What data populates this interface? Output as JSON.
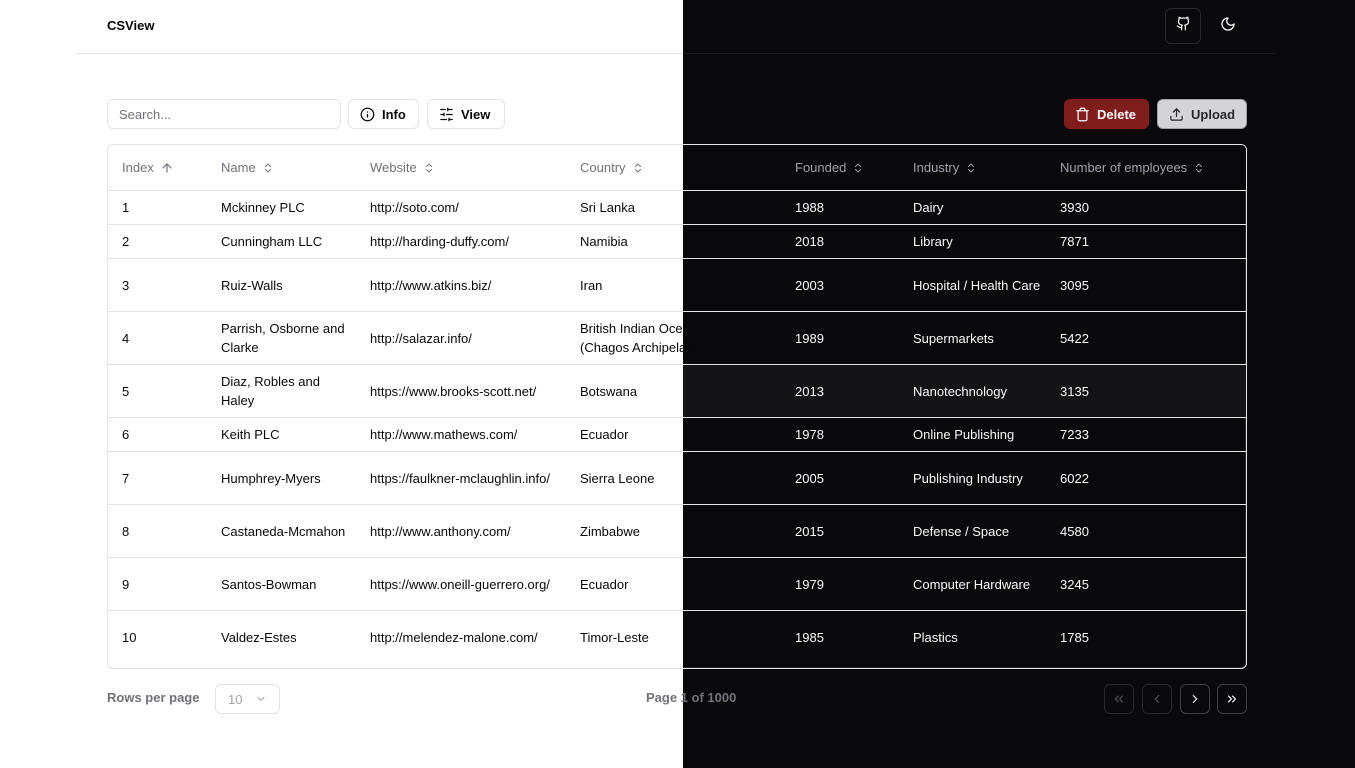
{
  "header": {
    "title": "CSView"
  },
  "toolbar": {
    "search_placeholder": "Search...",
    "info_label": "Info",
    "view_label": "View",
    "delete_label": "Delete",
    "upload_label": "Upload"
  },
  "table": {
    "columns": [
      "Index",
      "Name",
      "Website",
      "Country",
      "Founded",
      "Industry",
      "Number of employees"
    ],
    "rows": [
      [
        "1",
        "Mckinney PLC",
        "http://soto.com/",
        "Sri Lanka",
        "1988",
        "Dairy",
        "3930"
      ],
      [
        "2",
        "Cunningham LLC",
        "http://harding-duffy.com/",
        "Namibia",
        "2018",
        "Library",
        "7871"
      ],
      [
        "3",
        "Ruiz-Walls",
        "http://www.atkins.biz/",
        "Iran",
        "2003",
        "Hospital / Health Care",
        "3095"
      ],
      [
        "4",
        "Parrish, Osborne and Clarke",
        "http://salazar.info/",
        "British Indian Ocean Territory (Chagos Archipelago)",
        "1989",
        "Supermarkets",
        "5422"
      ],
      [
        "5",
        "Diaz, Robles and Haley",
        "https://www.brooks-scott.net/",
        "Botswana",
        "2013",
        "Nanotechnology",
        "3135"
      ],
      [
        "6",
        "Keith PLC",
        "http://www.mathews.com/",
        "Ecuador",
        "1978",
        "Online Publishing",
        "7233"
      ],
      [
        "7",
        "Humphrey-Myers",
        "https://faulkner-mclaughlin.info/",
        "Sierra Leone",
        "2005",
        "Publishing Industry",
        "6022"
      ],
      [
        "8",
        "Castaneda-Mcmahon",
        "http://www.anthony.com/",
        "Zimbabwe",
        "2015",
        "Defense / Space",
        "4580"
      ],
      [
        "9",
        "Santos-Bowman",
        "https://www.oneill-guerrero.org/",
        "Ecuador",
        "1979",
        "Computer Hardware",
        "3245"
      ],
      [
        "10",
        "Valdez-Estes",
        "http://melendez-malone.com/",
        "Timor-Leste",
        "1985",
        "Plastics",
        "1785"
      ]
    ]
  },
  "footer": {
    "rows_per_page_label": "Rows per page",
    "rows_per_page_value": "10",
    "page_prefix": "Page 1",
    "page_suffix": " of 1000"
  },
  "colors": {
    "light_bg": "#ffffff",
    "dark_bg": "#09090b",
    "delete_bg": "#7f1d1d",
    "upload_bg": "#d4d4d8"
  },
  "icons": [
    "github-icon",
    "moon-icon",
    "info-icon",
    "sliders-icon",
    "trash-icon",
    "upload-icon",
    "sort-asc-icon",
    "sort-icon",
    "chevron-down-icon",
    "chevrons-left-icon",
    "chevron-left-icon",
    "chevron-right-icon",
    "chevrons-right-icon"
  ]
}
